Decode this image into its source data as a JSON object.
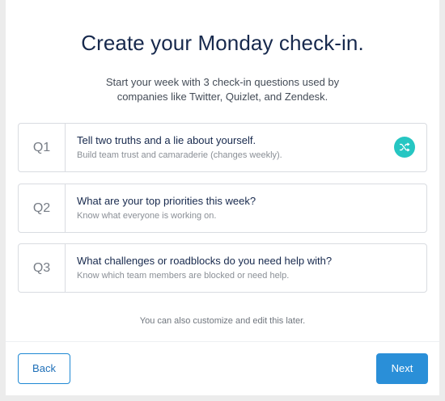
{
  "header": {
    "title": "Create your Monday check-in.",
    "subtitle_line1": "Start your week with 3 check-in questions used by",
    "subtitle_line2": "companies like Twitter, Quizlet, and Zendesk."
  },
  "questions": [
    {
      "number": "Q1",
      "title": "Tell two truths and a lie about yourself.",
      "description": "Build team trust and camaraderie (changes weekly).",
      "icon": "shuffle-icon"
    },
    {
      "number": "Q2",
      "title": "What are your top priorities this week?",
      "description": "Know what everyone is working on."
    },
    {
      "number": "Q3",
      "title": "What challenges or roadblocks do you need help with?",
      "description": "Know which team members are blocked or need help."
    }
  ],
  "footnote": "You can also customize and edit this later.",
  "footer": {
    "back_label": "Back",
    "next_label": "Next"
  },
  "colors": {
    "accent": "#2a8fd8",
    "shuffle": "#26c6c2",
    "title": "#17294d"
  }
}
